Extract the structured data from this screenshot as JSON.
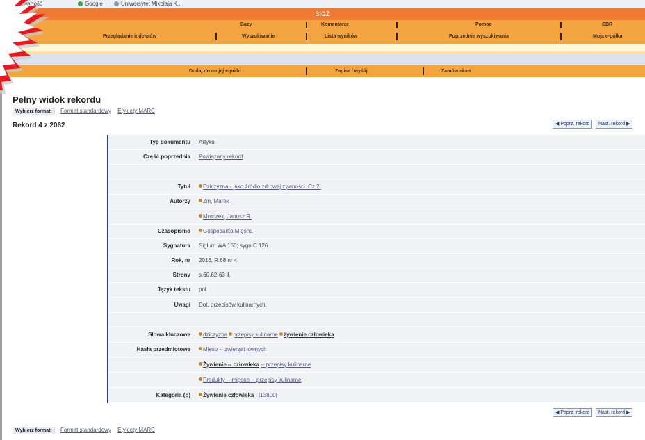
{
  "bookmarks": [
    {
      "label": "... zawartość",
      "dot": "#7ab04a"
    },
    {
      "label": "Google",
      "dot": "#3aa54a"
    },
    {
      "label": "Uniwersytet Mikołaja K...",
      "dot": "#8899aa"
    }
  ],
  "nav": {
    "brand": "SIGŻ",
    "row1": [
      "Bazy",
      "Komentarze",
      "Pomoc",
      "CBR"
    ],
    "row2": [
      "Przeglądanie indeksów",
      "Wyszukiwanie",
      "Lista wyników",
      "Poprzednie wyszukiwania",
      "Moja e-półka"
    ]
  },
  "actions": [
    "Dodaj do mojej e-półki",
    "Zapisz / wyślij",
    "Zamów skan"
  ],
  "page": {
    "title": "Pełny widok rekordu",
    "format_label": "Wybierz format:",
    "format_standard": "Format standardowy",
    "format_marc": "Etykiety MARC",
    "record_counter": "Rekord 4 z 2062",
    "prev": "◀ Poprz. rekord",
    "next": "Nast. rekord ▶"
  },
  "record": {
    "typ_label": "Typ dokumentu",
    "typ": "Artykuł",
    "czesc_label": "Część poprzednia",
    "czesc": "Powiązany rekord",
    "tytul_label": "Tytuł",
    "tytul": "Dziczyzna - jako źródło zdrowej żywności. Cz.2.",
    "autorzy_label": "Autorzy",
    "autor1": "Zin, Marek",
    "autor2": "Mroczek, Janusz R.",
    "czasopismo_label": "Czasopismo",
    "czasopismo": "Gospodarka Mięsna",
    "sygnatura_label": "Sygnatura",
    "sygnatura": "Siglum WA 163; sygn.C 126",
    "rok_label": "Rok, nr",
    "rok": "2016, R.68 nr 4",
    "strony_label": "Strony",
    "strony": "s.60,62-63 il.",
    "jezyk_label": "Język tekstu",
    "jezyk": "pol",
    "uwagi_label": "Uwagi",
    "uwagi": "Dot. przepisów kulinarnych.",
    "slowa_label": "Słowa kluczowe",
    "slowo1": "dziczyzna",
    "slowo2": "przepisy kulinarne",
    "slowo3": "żywienie człowieka",
    "hasla_label": "Hasła przedmiotowe",
    "haslo1": "Mięso -- zwierząt łownych",
    "haslo2a": "Żywienie -- człowieka",
    "haslo2b": "-- przepisy kulinarne",
    "haslo3": "Produkty -- mięsne -- przepisy kulinarne",
    "kategoria_label": "Kategoria (p)",
    "kategoria": "Żywienie człowieka",
    "kategoria_code": "[13800]"
  }
}
